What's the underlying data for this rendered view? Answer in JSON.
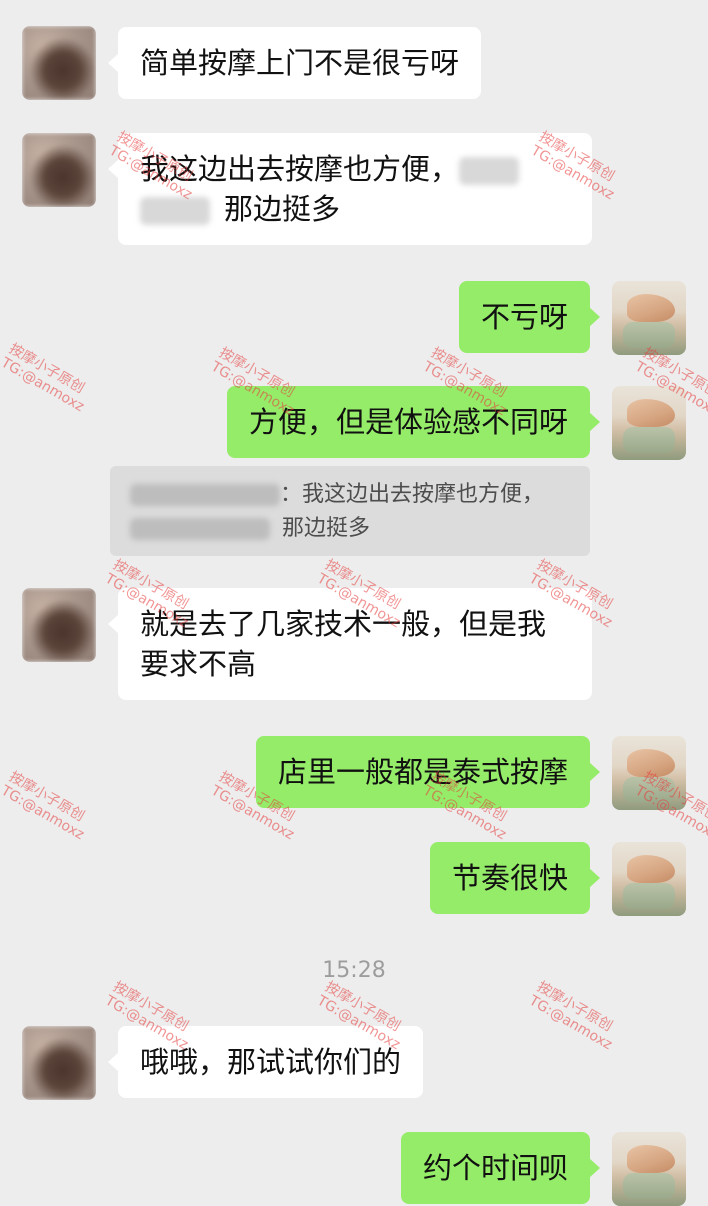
{
  "messages": [
    {
      "side": "left",
      "text": "简单按摩上门不是很亏呀"
    },
    {
      "side": "left",
      "text_a": "我这边出去按摩也方便，",
      "text_b": "那边挺多"
    },
    {
      "side": "right",
      "text": "不亏呀"
    },
    {
      "side": "right",
      "text": "方便，但是体验感不同呀"
    },
    {
      "side": "left",
      "text": "就是去了几家技术一般，但是我",
      "text2": "要求不高"
    },
    {
      "side": "right",
      "text": "店里一般都是泰式按摩"
    },
    {
      "side": "right",
      "text": "节奏很快"
    },
    {
      "side": "left",
      "text": "哦哦，那试试你们的"
    },
    {
      "side": "right",
      "text": "约个时间呗"
    }
  ],
  "quote": {
    "line1": "：我这边出去按摩也方便，",
    "line2": "那边挺多"
  },
  "timestamp": "15:28",
  "watermark": {
    "line1": "按摩小子原创",
    "line2": "TG:@anmoxz",
    "color": "#e63c3c"
  },
  "colors": {
    "background": "#ededed",
    "bubble_self": "#95ec69",
    "bubble_other": "#ffffff"
  }
}
